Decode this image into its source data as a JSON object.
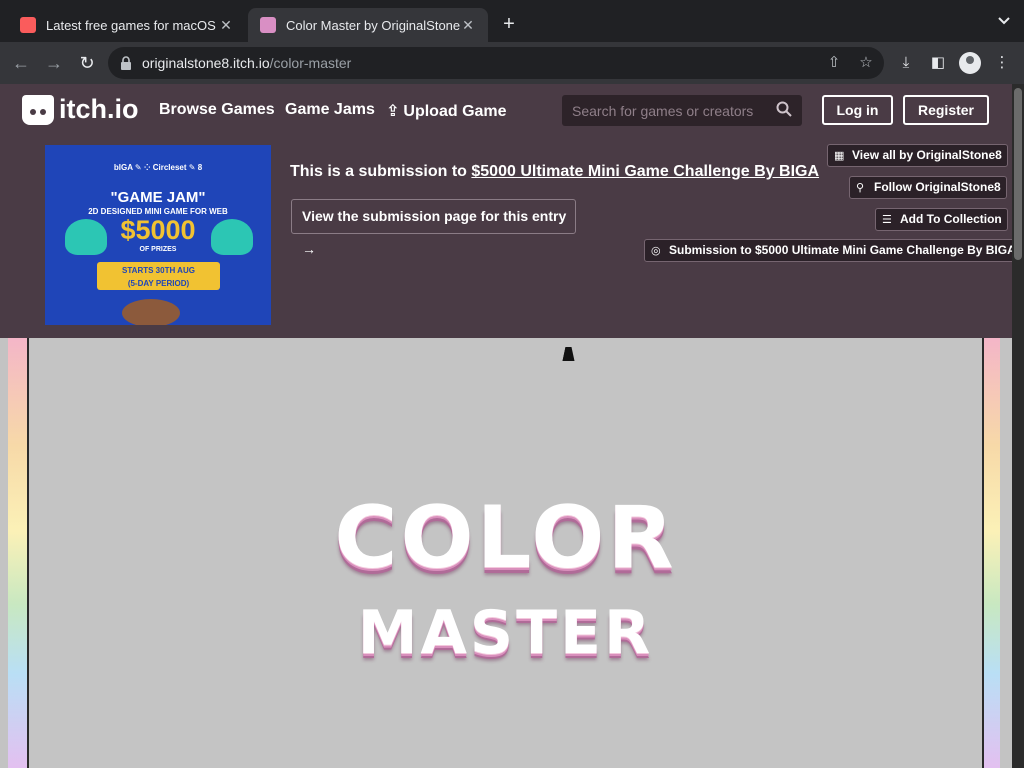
{
  "browser": {
    "tabs": [
      {
        "title": "Latest free games for macOS -",
        "close": "✕",
        "active": false
      },
      {
        "title": "Color Master by OriginalStone8",
        "close": "✕",
        "active": true
      }
    ],
    "new_tab": "+",
    "url_host": "originalstone8.itch.io",
    "url_path": "/color-master"
  },
  "header": {
    "logo": "itch.io",
    "nav": [
      "Browse Games",
      "Game Jams",
      "Upload Game"
    ],
    "search_placeholder": "Search for games or creators",
    "login": "Log in",
    "register": "Register"
  },
  "jam": {
    "banner": {
      "sponsors": "bIGA ✎ ⁘ Circleset ✎ 8",
      "headline": "\"GAME JAM\"",
      "subtitle": "2D DESIGNED MINI GAME FOR WEB",
      "prize": "$5000",
      "prize_label": "OF PRIZES",
      "dates_1": "STARTS 30TH AUG",
      "dates_2": "(5-DAY PERIOD)"
    },
    "prefix": "This is a submission to ",
    "link": "$5000 Ultimate Mini Game Challenge By BIGA",
    "view_button": "View the submission page for this entry →",
    "buttons": {
      "view_all": "View all by OriginalStone8",
      "follow": "Follow OriginalStone8",
      "collection": "Add To Collection",
      "submission": "Submission to $5000 Ultimate Mini Game Challenge By BIGA"
    }
  },
  "game": {
    "title_line1": "COLOR",
    "title_line2": "MASTER"
  },
  "colors": {
    "header_bg": "#4a3b45",
    "chrome_bg": "#202124",
    "game_bg": "#c4c4c4",
    "title_pink": "#d98fbc"
  }
}
